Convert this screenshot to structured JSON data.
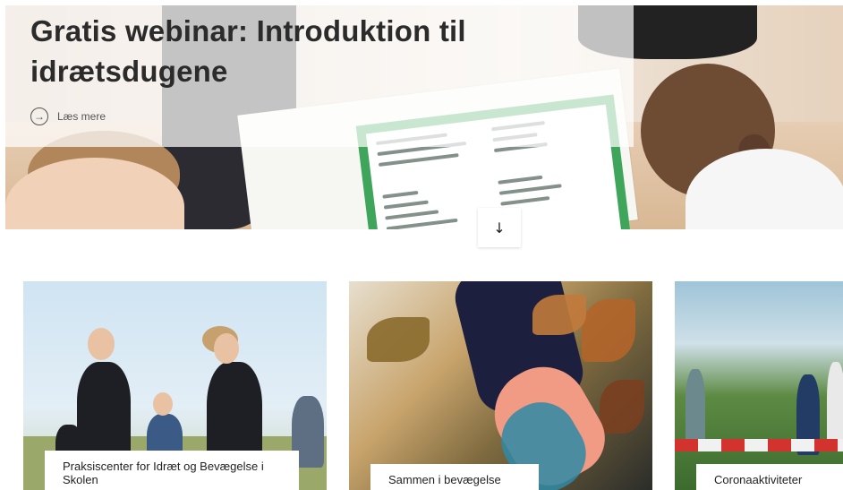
{
  "hero": {
    "title": "Gratis webinar: Introduktion til idrætsdugene",
    "read_more": "Læs mere",
    "read_more_icon": "arrow-right-icon",
    "scroll_icon": "arrow-down-icon"
  },
  "cards": [
    {
      "label": "Praksiscenter for Idræt og Bevægelse i Skolen"
    },
    {
      "label": "Sammen i bevægelse"
    },
    {
      "label": "Coronaaktiviteter"
    }
  ],
  "colors": {
    "text": "#2b2b2b",
    "overlay": "rgba(255,255,255,0.72)",
    "poster_green": "#3fa55b",
    "tape_red": "#d2332f"
  }
}
